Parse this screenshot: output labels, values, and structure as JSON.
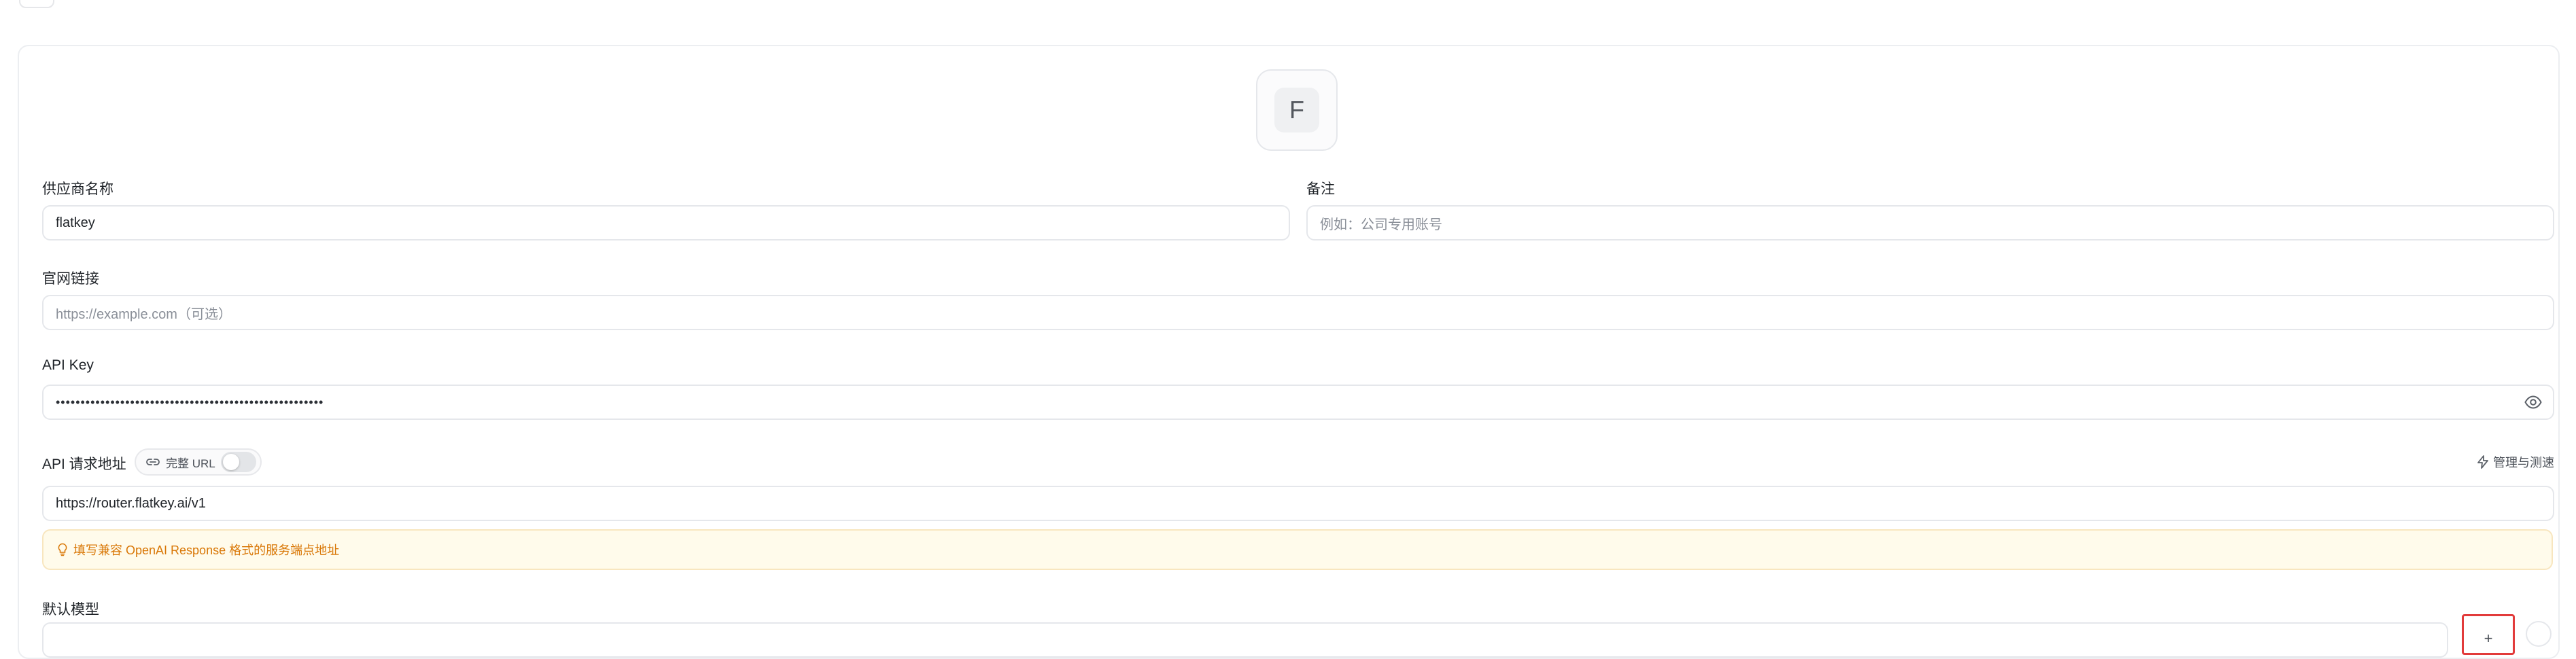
{
  "avatar": {
    "letter": "F"
  },
  "provider_name": {
    "label": "供应商名称",
    "value": "flatkey"
  },
  "notes": {
    "label": "备注",
    "placeholder": "例如：公司专用账号"
  },
  "website": {
    "label": "官网链接",
    "placeholder": "https://example.com（可选）"
  },
  "api_key": {
    "label": "API Key",
    "masked_value": "••••••••••••••••••••••••••••••••••••••••••••••••••••••",
    "toggle_icon": "eye-icon"
  },
  "api_endpoint": {
    "label": "API 请求地址",
    "full_url_label": "完整 URL",
    "full_url_enabled": false,
    "manage_label": "管理与测速",
    "value": "https://router.flatkey.ai/v1",
    "hint": "填写兼容 OpenAI Response 格式的服务端点地址"
  },
  "default_model": {
    "label": "默认模型",
    "add_symbol": "+"
  },
  "colors": {
    "hint_text": "#d97706",
    "hint_bg": "#fffbeb",
    "highlight_border": "#e23b3b"
  }
}
